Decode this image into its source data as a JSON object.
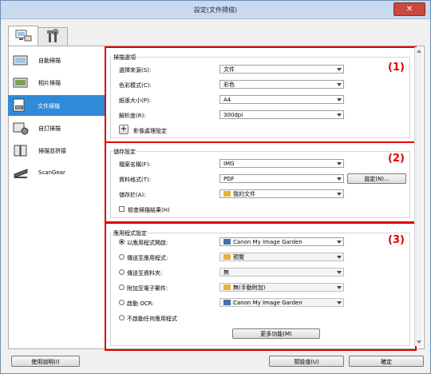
{
  "window_title": "設定(文件掃描)",
  "sidebar": [
    {
      "label": "自動掃描",
      "icon": "auto-scan-icon"
    },
    {
      "label": "相片掃描",
      "icon": "photo-scan-icon"
    },
    {
      "label": "文件掃描",
      "icon": "document-scan-icon",
      "selected": true
    },
    {
      "label": "自訂掃描",
      "icon": "custom-scan-icon"
    },
    {
      "label": "掃描並拼接",
      "icon": "scan-stitch-icon"
    },
    {
      "label": "ScanGear",
      "icon": "scangear-icon"
    }
  ],
  "scan_options": {
    "title": "掃描選項",
    "rows": [
      {
        "label": "選擇來源(S):",
        "value": "文件"
      },
      {
        "label": "色彩模式(C):",
        "value": "彩色"
      },
      {
        "label": "紙張大小(P):",
        "value": "A4"
      },
      {
        "label": "解析度(R):",
        "value": "300dpi"
      }
    ],
    "expand_label": "影像處理設定"
  },
  "save_settings": {
    "title": "儲存設定",
    "file_name_label": "檔案名稱(F):",
    "file_name_value": "IMG",
    "data_format_label": "資料格式(T):",
    "data_format_value": "PDF",
    "settings_button": "設定(N)...",
    "save_in_label": "儲存於(A):",
    "save_in_value": "我的文件",
    "check_label": "檢查掃描結果(H)"
  },
  "app_settings": {
    "title": "應用程式設定",
    "options": [
      {
        "label": "以應用程式開啟:",
        "value": "Canon My Image Garden",
        "checked": true
      },
      {
        "label": "傳送至應用程式:",
        "value": "預覽",
        "checked": false
      },
      {
        "label": "傳送至資料夾:",
        "value": "無",
        "checked": false
      },
      {
        "label": "附加至電子郵件:",
        "value": "無(手動附加)",
        "checked": false
      },
      {
        "label": "啟動 OCR:",
        "value": "Canon My Image Garden",
        "checked": false
      },
      {
        "label": "不啟動任何應用程式",
        "value": "",
        "checked": false
      }
    ],
    "more_button": "更多功能(M)"
  },
  "annotations": [
    "(1)",
    "(2)",
    "(3)"
  ],
  "footer": {
    "help_button": "使用說明(I)",
    "defaults_button": "預設值(U)",
    "ok_button": "確定"
  },
  "colors": {
    "accent": "#2e8bd8",
    "annotation": "#e00000"
  }
}
